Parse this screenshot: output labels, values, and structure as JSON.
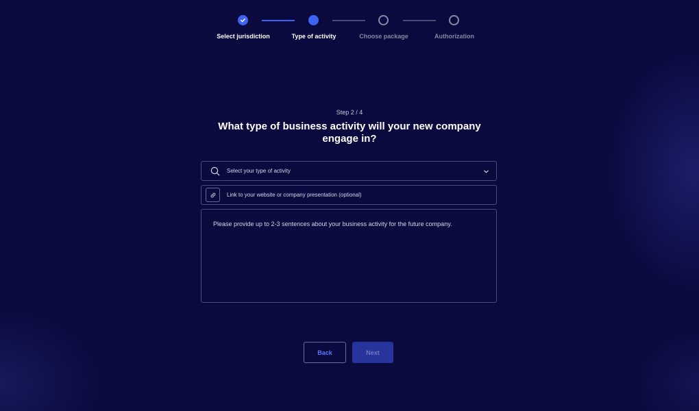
{
  "stepper": {
    "steps": [
      {
        "label": "Select jurisdiction",
        "state": "done"
      },
      {
        "label": "Type of activity",
        "state": "active"
      },
      {
        "label": "Choose package",
        "state": "todo"
      },
      {
        "label": "Authorization",
        "state": "todo"
      }
    ]
  },
  "heading": {
    "step_counter": "Step 2 / 4",
    "question": "What type of business activity will your new company engage in?"
  },
  "form": {
    "activity_select": {
      "placeholder": "Select your type of activity",
      "icon": "search-icon",
      "trailing_icon": "chevron-down-icon"
    },
    "website_link": {
      "placeholder": "Link to your website or company presentation (optional)",
      "icon": "link-icon"
    },
    "description": {
      "placeholder": "Please provide up to 2-3 sentences about your business activity for the future company."
    }
  },
  "actions": {
    "back_label": "Back",
    "next_label": "Next"
  },
  "colors": {
    "background": "#0b0a3e",
    "accent": "#3e63f0",
    "next_disabled": "#27349c"
  }
}
